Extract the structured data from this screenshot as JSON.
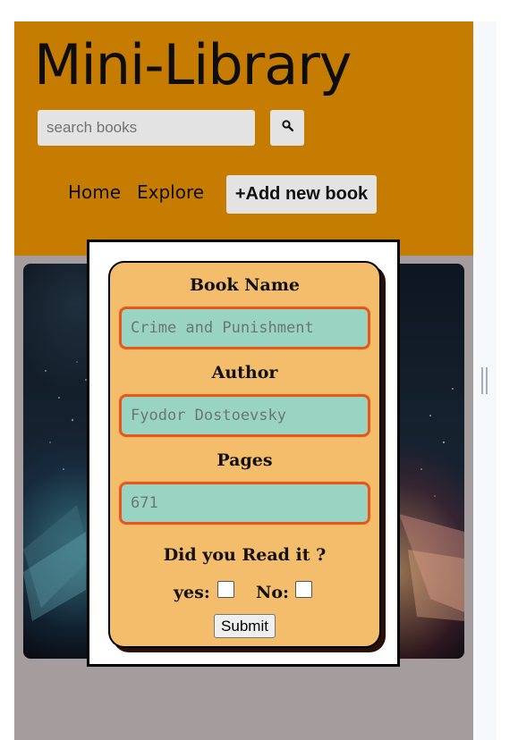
{
  "app": {
    "title": "Mini-Library"
  },
  "search": {
    "placeholder": "search books",
    "button_icon": "search-icon"
  },
  "nav": {
    "home": "Home",
    "explore": "Explore",
    "add_book": "+Add new book"
  },
  "form": {
    "book_name_label": "Book Name",
    "book_name_placeholder": "Crime and Punishment",
    "author_label": "Author",
    "author_placeholder": "Fyodor Dostoevsky",
    "pages_label": "Pages",
    "pages_placeholder": "671",
    "read_question": "Did you Read it ?",
    "yes_label": "yes:",
    "no_label": "No:",
    "yes_checked": false,
    "no_checked": false,
    "submit_label": "Submit"
  },
  "colors": {
    "header_bg": "#c67c00",
    "page_bg": "#a59c9d",
    "card_bg": "#f4bd6c",
    "input_bg": "#98d4c1",
    "input_border": "#ec5518"
  }
}
